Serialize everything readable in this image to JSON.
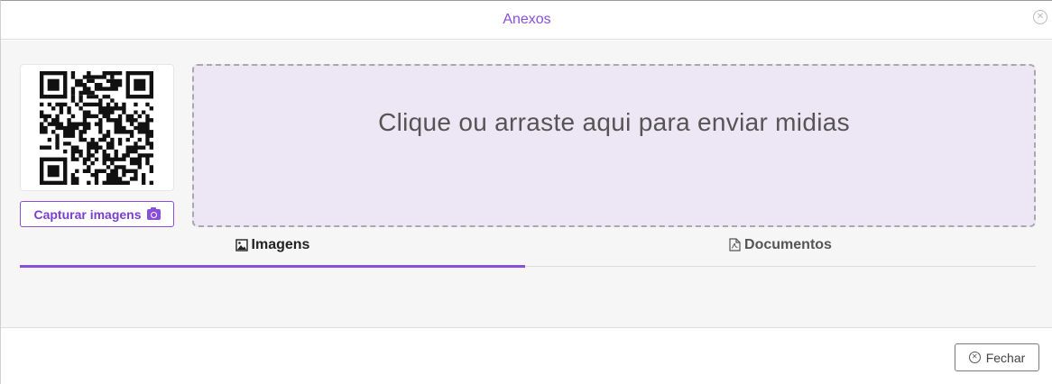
{
  "modal": {
    "title": "Anexos",
    "close_icon": "close-circle-icon"
  },
  "sidebar": {
    "qr_icon": "qr-code",
    "capture_label": "Capturar imagens",
    "capture_icon": "camera-icon"
  },
  "dropzone": {
    "text": "Clique ou arraste aqui para enviar midias"
  },
  "tabs": [
    {
      "label": "Imagens",
      "icon": "image-icon",
      "active": true
    },
    {
      "label": "Documentos",
      "icon": "pdf-file-icon",
      "active": false
    }
  ],
  "footer": {
    "close_label": "Fechar",
    "close_icon": "close-circle-icon"
  },
  "colors": {
    "accent": "#8a4fd8",
    "dropzone_bg": "#ede6f4",
    "body_bg": "#f6f6f6"
  }
}
